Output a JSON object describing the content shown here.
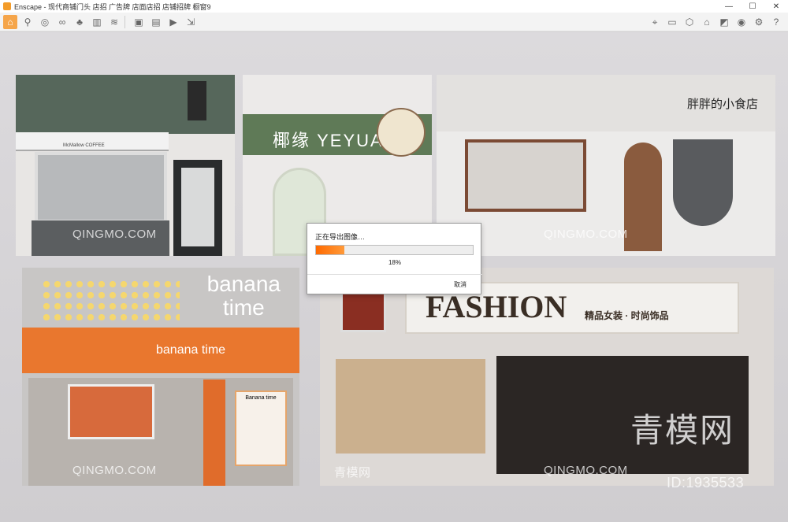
{
  "window": {
    "title": "Enscape - 现代商铺门头 店招 广告牌 店面店招 店铺招牌 橱窗9"
  },
  "window_controls": {
    "minimize": "—",
    "maximize": "☐",
    "close": "✕"
  },
  "colors": {
    "accent": "#f5a54a",
    "progress": "#ff6a00"
  },
  "toolbar": {
    "left_icons": [
      "home-icon",
      "walk-icon",
      "orbit-icon",
      "binoculars-icon",
      "tree-icon",
      "building-icon",
      "grass-icon",
      "export-image-icon",
      "batch-icon",
      "video-icon",
      "panorama-icon"
    ],
    "right_icons": [
      "views-icon",
      "screenshot-icon",
      "asset-icon",
      "library-icon",
      "material-icon",
      "eye-icon",
      "settings-icon",
      "help-icon"
    ]
  },
  "stores": {
    "s1": {
      "awning_text": "McMallow COFFEE"
    },
    "s2": {
      "sign": "椰缘  YEYUAN"
    },
    "s3": {
      "name": "胖胖的小食店"
    },
    "s4": {
      "brand_line1": "banana",
      "brand_line2": "time",
      "awning": "banana time",
      "board": "Banana time"
    },
    "s5": {
      "title": "FASHION",
      "subtitle": "精品女装 · 时尚饰品"
    }
  },
  "watermarks": {
    "qingmo": "QINGMO.COM",
    "brand": "青模网",
    "id": "ID:1935533"
  },
  "dialog": {
    "message": "正在导出图像…",
    "progress_value": 0.18,
    "progress_text": "18%",
    "cancel_label": "取消"
  }
}
